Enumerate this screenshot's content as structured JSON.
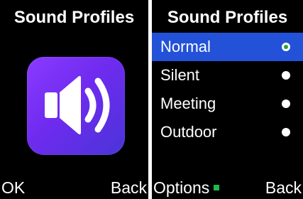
{
  "left": {
    "title": "Sound Profiles",
    "icon": "speaker-volume-icon",
    "softkeys": {
      "left": "OK",
      "right": "Back"
    }
  },
  "right": {
    "title": "Sound Profiles",
    "items": [
      {
        "label": "Normal",
        "selected": true,
        "checked": true
      },
      {
        "label": "Silent",
        "selected": false,
        "checked": false
      },
      {
        "label": "Meeting",
        "selected": false,
        "checked": false
      },
      {
        "label": "Outdoor",
        "selected": false,
        "checked": false
      }
    ],
    "softkeys": {
      "left": "Options",
      "right": "Back"
    }
  },
  "colors": {
    "background": "#000000",
    "highlight": "#2352d8",
    "icon_gradient_start": "#8a3bff",
    "icon_gradient_end": "#4a34d8",
    "radio_check": "#2e9f38",
    "options_indicator": "#1fb84a"
  }
}
